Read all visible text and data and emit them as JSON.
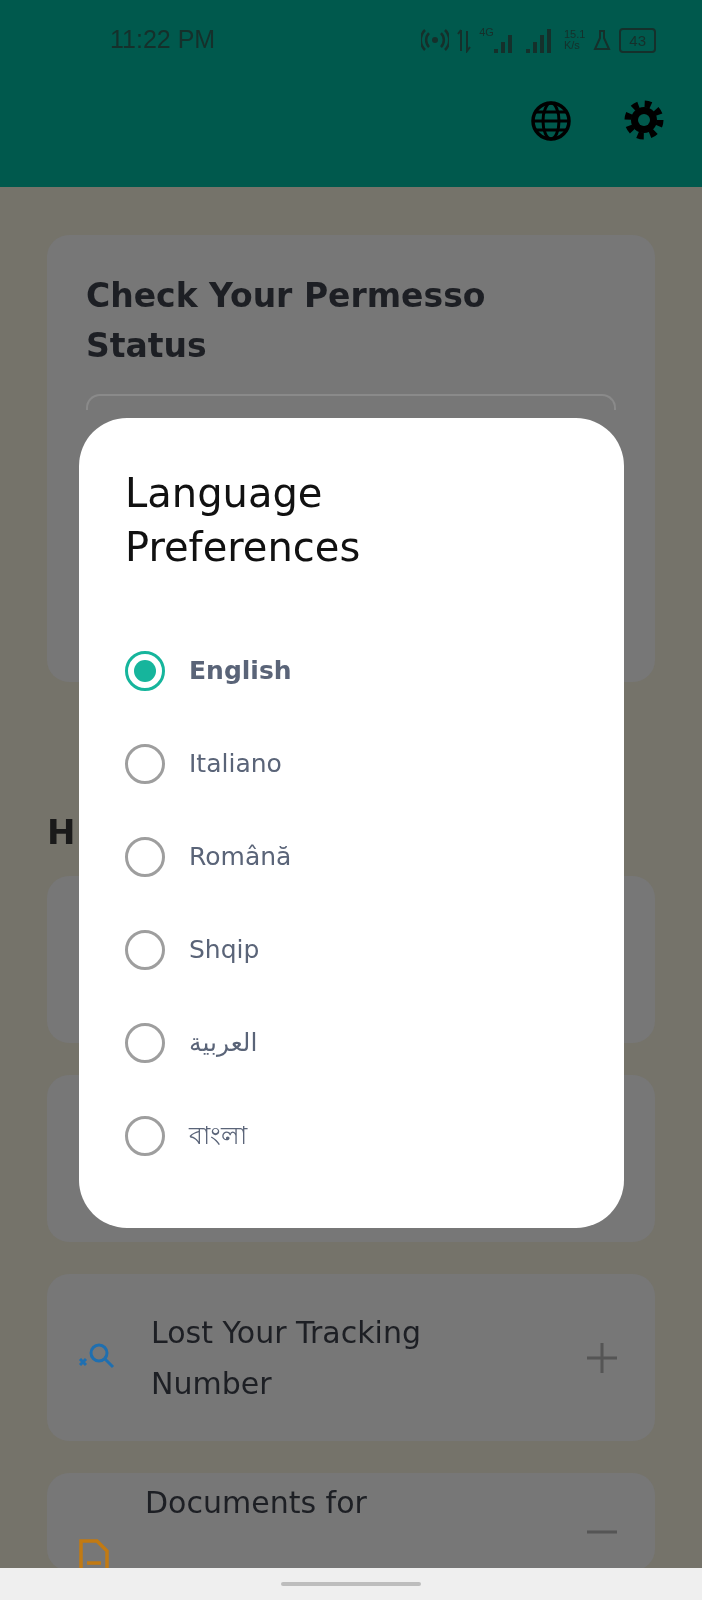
{
  "status_bar": {
    "time": "11:22 PM",
    "network": "4G",
    "speed_value": "15.1",
    "speed_unit": "K/s",
    "battery": "43"
  },
  "app_bar": {
    "actions": [
      {
        "kind": "language"
      },
      {
        "kind": "settings"
      }
    ]
  },
  "status_card": {
    "title": "Check Your Permesso Status"
  },
  "section_heading": "H",
  "help_items": [
    {
      "kind": "blank"
    },
    {
      "kind": "blank"
    },
    {
      "kind": "lost",
      "title": "Lost Your Tracking Number",
      "expanded": false
    },
    {
      "kind": "documents",
      "title": "Documents for",
      "expanded": true
    }
  ],
  "dialog": {
    "title": "Language Preferences",
    "options": [
      {
        "label": "English",
        "selected": true
      },
      {
        "label": "Italiano",
        "selected": false
      },
      {
        "label": "Română",
        "selected": false
      },
      {
        "label": "Shqip",
        "selected": false
      },
      {
        "label": "العربية",
        "selected": false
      },
      {
        "label": "বাংলা",
        "selected": false
      }
    ]
  }
}
